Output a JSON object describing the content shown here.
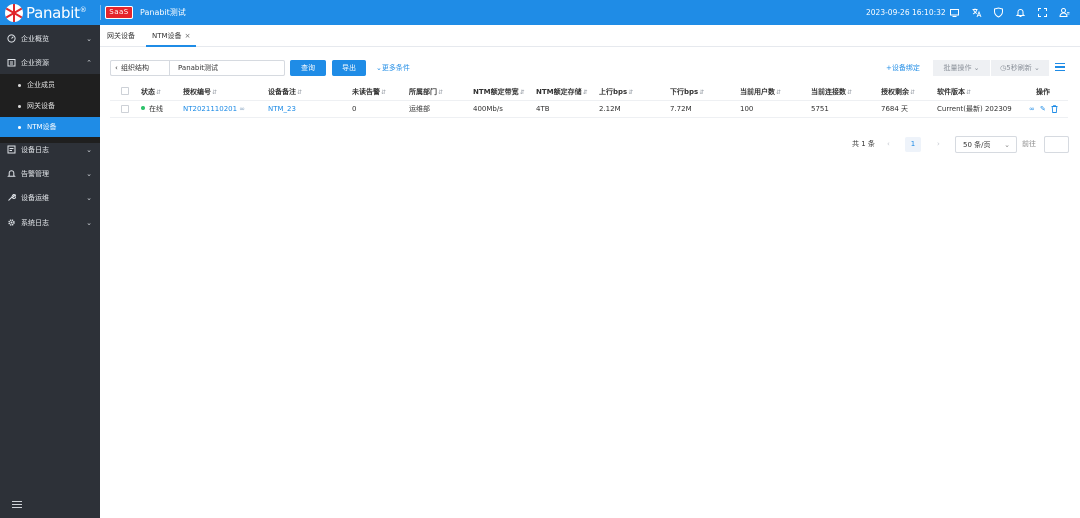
{
  "header": {
    "brand": "Panabit",
    "brand_mark": "®",
    "saas_badge": "SaaS",
    "org_name": "Panabit测试",
    "datetime": "2023-09-26 16:10:32",
    "icons": [
      "monitor-icon",
      "translate-icon",
      "shield-icon",
      "bell-icon",
      "fullscreen-icon",
      "user-settings-icon"
    ]
  },
  "sidebar": {
    "groups": [
      {
        "label": "企业概览",
        "icon": "dashboard-icon",
        "expanded": false
      },
      {
        "label": "企业资源",
        "icon": "building-icon",
        "expanded": true
      },
      {
        "label": "设备日志",
        "icon": "log-icon",
        "expanded": false
      },
      {
        "label": "告警管理",
        "icon": "bell-icon",
        "expanded": false
      },
      {
        "label": "设备运维",
        "icon": "wrench-icon",
        "expanded": false
      },
      {
        "label": "系统日志",
        "icon": "gear-icon",
        "expanded": false
      }
    ],
    "sub_items": [
      {
        "label": "企业成员",
        "active": false
      },
      {
        "label": "网关设备",
        "active": false
      },
      {
        "label": "NTM设备",
        "active": true
      }
    ]
  },
  "tabs": [
    {
      "label": "网关设备",
      "active": false
    },
    {
      "label": "NTM设备",
      "active": true,
      "close": "×"
    }
  ],
  "toolbar": {
    "back_label": "组织结构",
    "org_value": "Panabit测试",
    "query_label": "查询",
    "export_label": "导出",
    "more_label": "更多条件",
    "bind_label": "设备绑定",
    "batch_label": "批量操作",
    "refresh_label": "5秒刷新"
  },
  "table": {
    "columns": [
      "状态",
      "授权编号",
      "设备备注",
      "未读告警",
      "所属部门",
      "NTM额定带宽",
      "NTM额定存储",
      "上行bps",
      "下行bps",
      "当前用户数",
      "当前连接数",
      "授权剩余",
      "软件版本",
      "操作"
    ],
    "rows": [
      {
        "status": "在线",
        "license_no": "NT2021110201",
        "remark": "NTM_23",
        "unread_alerts": "0",
        "department": "运维部",
        "bandwidth": "400Mb/s",
        "storage": "4TB",
        "up_bps": "2.12M",
        "down_bps": "7.72M",
        "users": "100",
        "connections": "5751",
        "license_left": "7684 天",
        "version": "Current(最新) 202309"
      }
    ]
  },
  "pagination": {
    "total": "共 1 条",
    "current_page": "1",
    "page_size": "50 条/页",
    "goto_label": "前往"
  },
  "colors": {
    "primary": "#1f8ce6",
    "sidebar_bg": "#2d3138",
    "online": "#2ec26b",
    "saas_badge": "#e5242b"
  }
}
